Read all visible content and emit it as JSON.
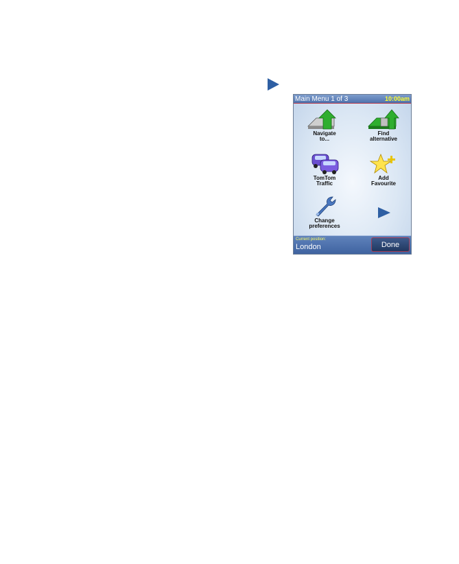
{
  "header": {
    "title": "Main Menu 1 of 3",
    "time": "10:00am"
  },
  "menu": {
    "items": [
      {
        "label_lines": [
          "Navigate",
          "to..."
        ],
        "icon": "navigate-arrow-icon"
      },
      {
        "label_lines": [
          "Find",
          "alternative"
        ],
        "icon": "alternative-route-icon"
      },
      {
        "label_lines": [
          "TomTom",
          "Traffic"
        ],
        "icon": "traffic-cars-icon"
      },
      {
        "label_lines": [
          "Add",
          "Favourite"
        ],
        "icon": "star-plus-icon"
      },
      {
        "label_lines": [
          "Change",
          "preferences"
        ],
        "icon": "wrench-icon"
      }
    ],
    "next_icon": "next-page-arrow-icon"
  },
  "footer": {
    "position_label": "Current position:",
    "position_value": "London",
    "done_label": "Done"
  },
  "colors": {
    "accent_blue": "#2e5fa3",
    "clock_yellow": "#ffff33",
    "arrow_green": "#2fae2f"
  }
}
